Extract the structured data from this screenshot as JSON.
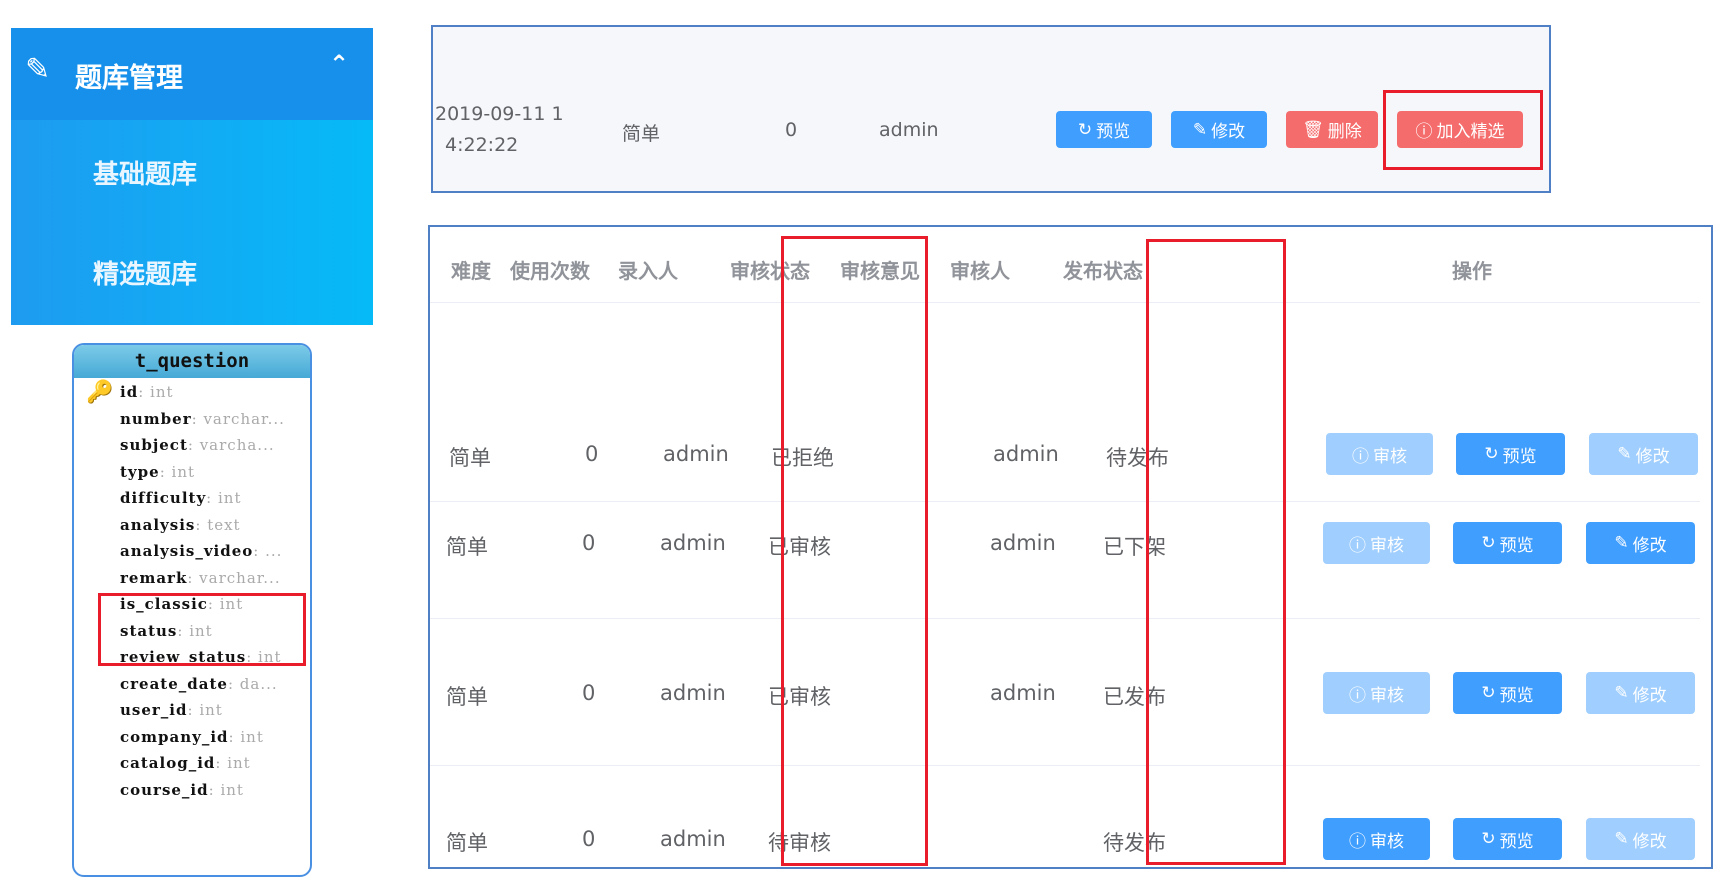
{
  "sidebar": {
    "title": "题库管理",
    "title_icon": "edit-doc-icon",
    "collapse_icon": "chevron-up-icon",
    "items": [
      {
        "label": "基础题库"
      },
      {
        "label": "精选题库"
      }
    ]
  },
  "schema": {
    "table": "t_question",
    "key_icon": "key-icon",
    "fields": [
      {
        "name": "id",
        "type": "int"
      },
      {
        "name": "number",
        "type": "varchar..."
      },
      {
        "name": "subject",
        "type": "varcha..."
      },
      {
        "name": "type",
        "type": "int"
      },
      {
        "name": "difficulty",
        "type": "int"
      },
      {
        "name": "analysis",
        "type": "text"
      },
      {
        "name": "analysis_video",
        "type": "..."
      },
      {
        "name": "remark",
        "type": "varchar..."
      },
      {
        "name": "is_classic",
        "type": "int"
      },
      {
        "name": "status",
        "type": "int"
      },
      {
        "name": "review_status",
        "type": "int"
      },
      {
        "name": "create_date",
        "type": "da..."
      },
      {
        "name": "user_id",
        "type": "int"
      },
      {
        "name": "company_id",
        "type": "int"
      },
      {
        "name": "catalog_id",
        "type": "int"
      },
      {
        "name": "course_id",
        "type": "int"
      }
    ]
  },
  "top_row": {
    "date_line1": "2019-09-11 1",
    "date_line2": "4:22:22",
    "difficulty": "简单",
    "uses": "0",
    "creator": "admin",
    "buttons": {
      "preview": "预览",
      "edit": "修改",
      "delete": "删除",
      "add_featured": "加入精选"
    }
  },
  "table": {
    "headers": [
      "难度",
      "使用次数",
      "录入人",
      "审核状态",
      "审核意见",
      "审核人",
      "发布状态",
      "操作"
    ],
    "rows": [
      {
        "difficulty": "简单",
        "uses": "0",
        "creator": "admin",
        "review_status": "已拒绝",
        "review_comment": "",
        "reviewer": "admin",
        "publish_status": "待发布",
        "review_enabled": false,
        "edit_enabled": false
      },
      {
        "difficulty": "简单",
        "uses": "0",
        "creator": "admin",
        "review_status": "已审核",
        "review_comment": "",
        "reviewer": "admin",
        "publish_status": "已下架",
        "review_enabled": false,
        "edit_enabled": true
      },
      {
        "difficulty": "简单",
        "uses": "0",
        "creator": "admin",
        "review_status": "已审核",
        "review_comment": "",
        "reviewer": "admin",
        "publish_status": "已发布",
        "review_enabled": false,
        "edit_enabled": false
      },
      {
        "difficulty": "简单",
        "uses": "0",
        "creator": "admin",
        "review_status": "待审核",
        "review_comment": "",
        "reviewer": "",
        "publish_status": "待发布",
        "review_enabled": true,
        "edit_enabled": false
      }
    ],
    "buttons": {
      "review": "审核",
      "preview": "预览",
      "edit": "修改"
    }
  },
  "colors": {
    "primary": "#409eff",
    "primary_disabled": "#a0cfff",
    "danger": "#f56c6c",
    "highlight": "#e81c2b"
  }
}
